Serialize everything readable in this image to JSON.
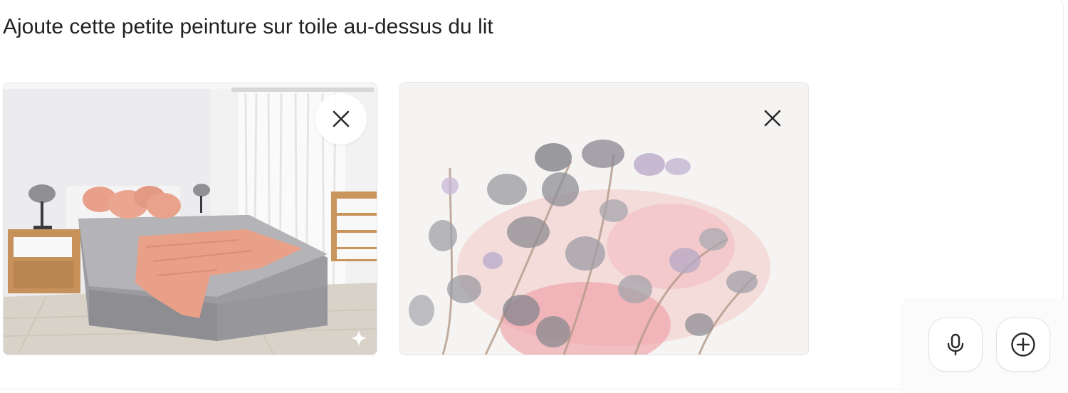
{
  "prompt": {
    "text": "Ajoute cette petite peinture sur toile au-dessus du lit"
  },
  "attachments": [
    {
      "kind": "photo",
      "subject": "bedroom",
      "remove_icon": "close-icon",
      "badge_icon": "sparkle-icon"
    },
    {
      "kind": "painting",
      "subject": "watercolor eucalyptus",
      "remove_icon": "close-icon"
    }
  ],
  "toolbar": {
    "mic_icon": "microphone-icon",
    "add_icon": "plus-circle-icon"
  },
  "colors": {
    "text": "#222222",
    "border": "#e2e2e2",
    "accent_pink": "#e8a08a",
    "bedding_gray": "#9c9ca0"
  }
}
